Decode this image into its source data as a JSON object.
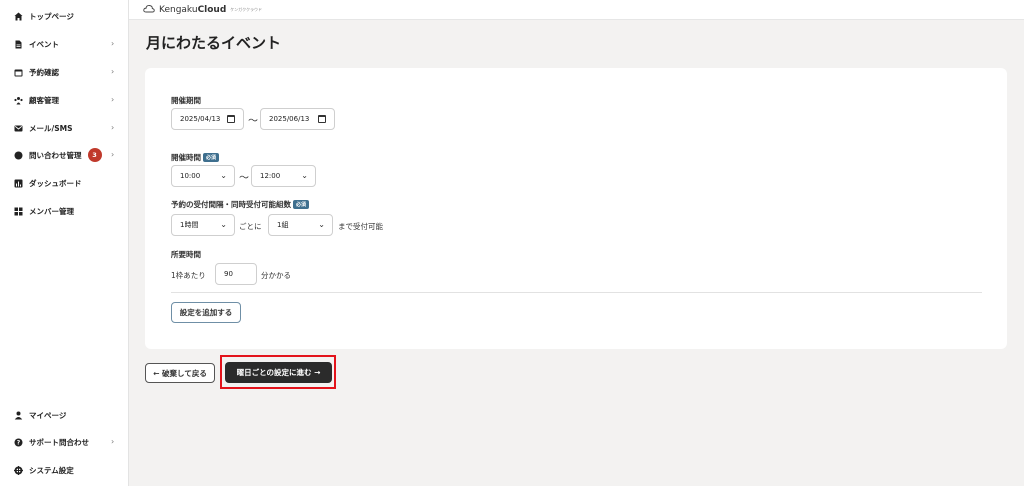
{
  "app": {
    "logo_text_light": "Kengaku",
    "logo_text_bold": "Cloud",
    "logo_sub": "ケンガククラウド"
  },
  "sidebar": {
    "items": [
      {
        "label": "トップページ",
        "icon": "home-icon"
      },
      {
        "label": "イベント",
        "icon": "document-icon",
        "chevron": "›"
      },
      {
        "label": "予約確認",
        "icon": "calendar-icon",
        "chevron": "›"
      },
      {
        "label": "顧客管理",
        "icon": "users-icon",
        "chevron": "›"
      },
      {
        "label": "メール/SMS",
        "icon": "mail-icon",
        "chevron": "›"
      },
      {
        "label": "問い合わせ管理",
        "icon": "chat-icon",
        "chevron": "›",
        "badge": "3"
      },
      {
        "label": "ダッシュボード",
        "icon": "chart-icon"
      },
      {
        "label": "メンバー管理",
        "icon": "grid-icon"
      }
    ],
    "bottom_items": [
      {
        "label": "マイページ",
        "icon": "person-icon"
      },
      {
        "label": "サポート問合わせ",
        "icon": "help-icon",
        "chevron": "›"
      },
      {
        "label": "システム設定",
        "icon": "gear-icon"
      }
    ]
  },
  "page": {
    "title": "月にわたるイベント"
  },
  "form": {
    "period_label": "開催期間",
    "start_date": "2025/04/13",
    "end_date": "2025/06/13",
    "tilde": "〜",
    "time_label": "開催時間",
    "required": "必須",
    "start_time": "10:00",
    "end_time": "12:00",
    "interval_label": "予約の受付間隔・同時受付可能組数",
    "interval_value": "1時間",
    "per_text": "ごとに",
    "groups_value": "1組",
    "until_text": "まで受付可能",
    "duration_label": "所要時間",
    "per_slot_text": "1枠あたり",
    "duration_value": "90",
    "minutes_text": "分かかる",
    "add_setting": "設定を追加する"
  },
  "actions": {
    "back": "← 破棄して戻る",
    "next": "曜日ごとの設定に進む →"
  },
  "colors": {
    "badge": "#c0392b",
    "required_tag": "#3e6f8e",
    "highlight": "#e3131b",
    "primary_button": "#2b2b2b"
  }
}
